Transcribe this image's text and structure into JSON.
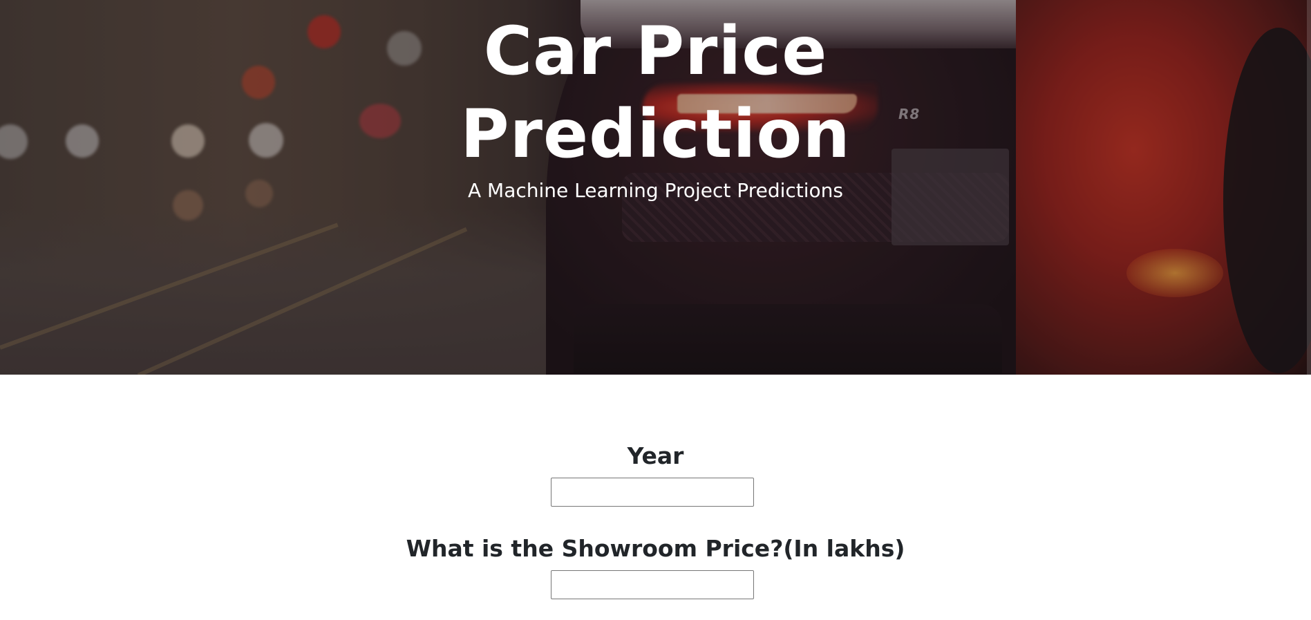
{
  "hero": {
    "title_line1": "Car Price",
    "title_line2": "Prediction",
    "subtitle": "A Machine Learning Project Predictions",
    "car_badge": "R8"
  },
  "form": {
    "fields": [
      {
        "label": "Year",
        "value": "",
        "placeholder": ""
      },
      {
        "label": "What is the Showroom Price?(In lakhs)",
        "value": "",
        "placeholder": ""
      }
    ]
  },
  "colors": {
    "hero_text": "#ffffff",
    "label_text": "#212529",
    "page_background": "#ffffff",
    "input_border": "#767676"
  }
}
